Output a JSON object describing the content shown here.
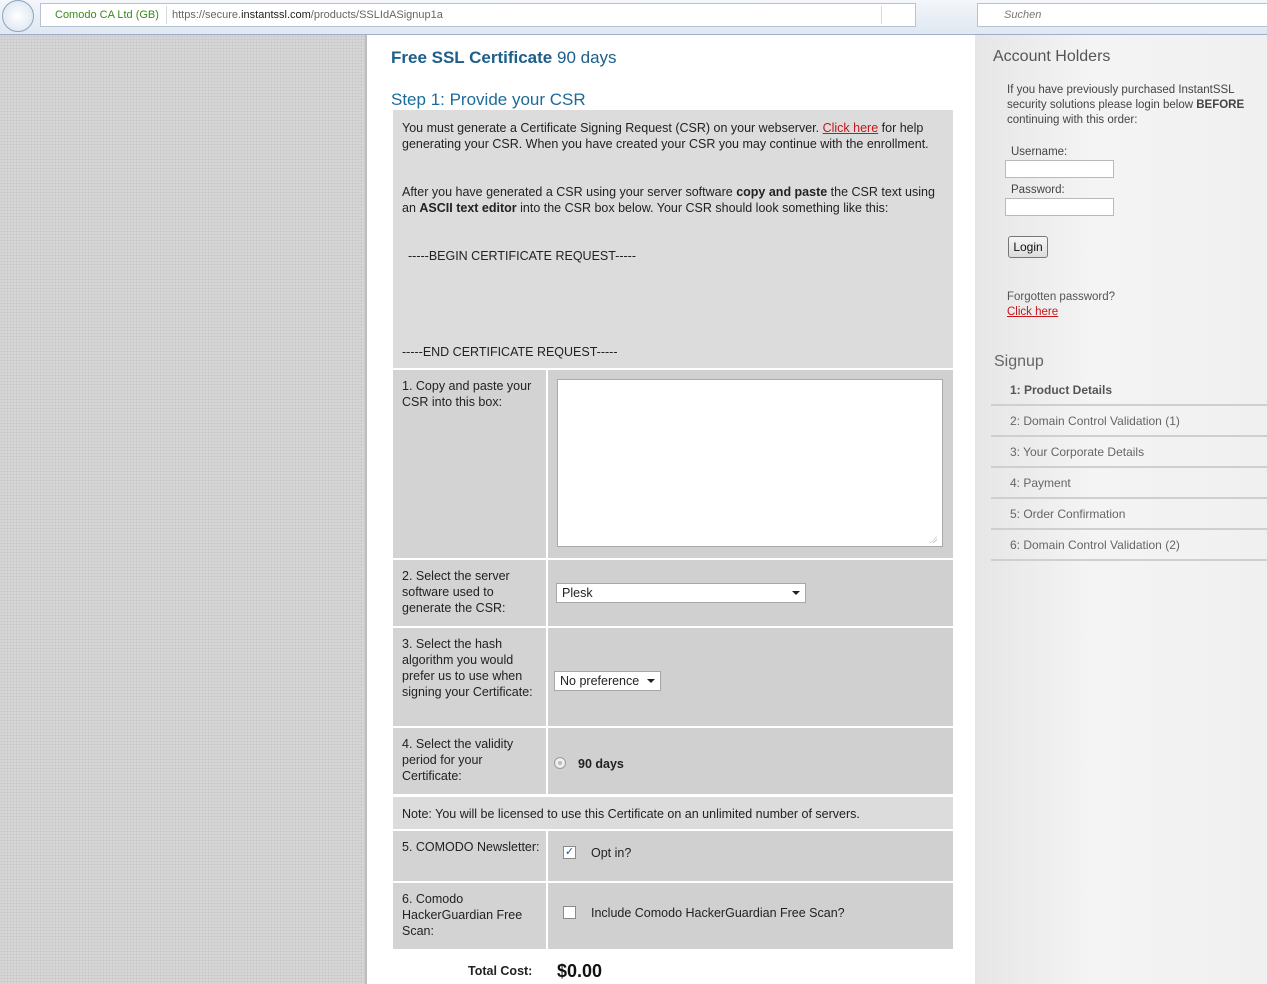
{
  "browser": {
    "identity": "Comodo CA Ltd (GB)",
    "url_prefix": "https://secure.",
    "url_domain": "instantssl.com",
    "url_path": "/products/SSLIdASignup1a",
    "search_placeholder": "Suchen"
  },
  "page": {
    "title_strong": "Free SSL Certificate",
    "title_rest": " 90 days",
    "step_heading": "Step 1: Provide your CSR",
    "csr_intro_1": "You must generate a Certificate Signing Request (CSR) on your webserver. ",
    "csr_intro_link": "Click here",
    "csr_intro_2": " for help generating your CSR. When you have created your CSR you may continue with the enrollment.",
    "csr_after_1": "After you have generated a CSR using your server software ",
    "csr_after_bold1": "copy and paste",
    "csr_after_2": " the CSR text using an ",
    "csr_after_bold2": "ASCII text editor",
    "csr_after_3": " into the CSR box below. Your CSR should look something like this:",
    "csr_begin": "-----BEGIN CERTIFICATE REQUEST-----",
    "csr_end": "-----END CERTIFICATE REQUEST-----",
    "row1_label": "1. Copy and paste your CSR into this box:",
    "row1_value": "",
    "row2_label": "2. Select the server software used to generate the CSR:",
    "row2_value": "Plesk",
    "row3_label": "3. Select the hash algorithm you would prefer us to use when signing your Certificate:",
    "row3_value": "No preference",
    "row4_label": "4. Select the validity period for your Certificate:",
    "row4_value": "90 days",
    "note": "Note: You will be licensed to use this Certificate on an unlimited number of servers.",
    "row5_label": "5. COMODO Newsletter:",
    "row5_value": "Opt in?",
    "row6_label": "6. Comodo HackerGuardian Free Scan:",
    "row6_value": "Include Comodo HackerGuardian Free Scan?",
    "total_label": "Total Cost:",
    "total_value": "$0.00"
  },
  "sidebar": {
    "account_heading": "Account Holders",
    "account_text_1": "If you have previously purchased InstantSSL security solutions please login below ",
    "account_text_bold": "BEFORE",
    "account_text_2": " continuing with this order:",
    "username_label": "Username:",
    "password_label": "Password:",
    "login_label": "Login",
    "forgot_text": "Forgotten password?",
    "forgot_link": "Click here",
    "signup_heading": "Signup",
    "steps": [
      "1:  Product Details",
      "2:  Domain Control Validation (1)",
      "3:  Your Corporate Details",
      "4:  Payment",
      "5:  Order Confirmation",
      "6:  Domain Control Validation (2)"
    ]
  }
}
